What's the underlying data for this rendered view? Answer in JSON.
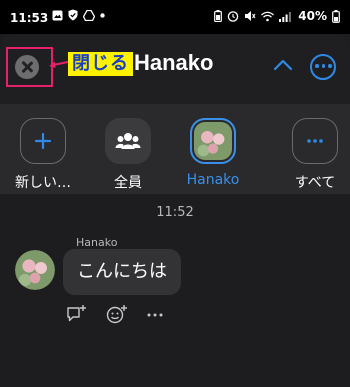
{
  "status_bar": {
    "time": "11:53",
    "battery": "40%"
  },
  "header": {
    "close_annotation": "閉じる",
    "title": "Hanako",
    "close_icon": "close-circle-icon",
    "collapse_icon": "chevron-up-icon",
    "more_icon": "more-horizontal-circle-icon"
  },
  "share_targets": [
    {
      "label": "新しい…",
      "icon": "plus-icon"
    },
    {
      "label": "全員",
      "icon": "group-icon"
    },
    {
      "label": "Hanako",
      "icon": "profile-photo",
      "selected": true
    },
    {
      "label": "すべて",
      "icon": "more-horizontal-icon"
    }
  ],
  "chat": {
    "timestamp": "11:52",
    "sender": "Hanako",
    "message": "こんにちは",
    "actions": [
      "reply-add-icon",
      "emoji-add-icon",
      "more-horizontal-icon"
    ]
  },
  "colors": {
    "accent": "#2d8ae6",
    "highlight_border": "#e6216c",
    "annotation_bg": "#fff200",
    "annotation_text": "#1a3fbf"
  }
}
